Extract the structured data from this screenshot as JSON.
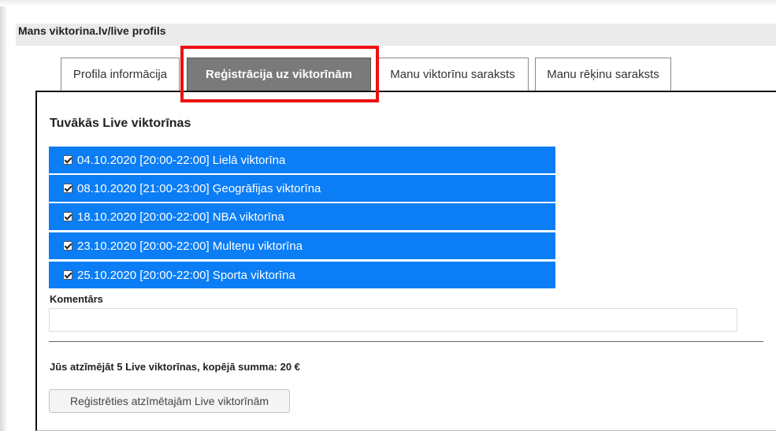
{
  "header": {
    "title": "Mans viktorina.lv/live profils"
  },
  "tabs": [
    {
      "label": "Profila informācija",
      "active": false
    },
    {
      "label": "Reģistrācija uz viktorīnām",
      "active": true
    },
    {
      "label": "Manu viktorīnu saraksts",
      "active": false
    },
    {
      "label": "Manu rēķinu saraksts",
      "active": false
    }
  ],
  "section": {
    "title": "Tuvākās Live viktorīnas"
  },
  "quizzes": [
    {
      "label": "04.10.2020 [20:00-22:00] Lielā viktorīna",
      "checked": true
    },
    {
      "label": "08.10.2020 [21:00-23:00] Ģeogrāfijas viktorīna",
      "checked": true
    },
    {
      "label": "18.10.2020 [20:00-22:00] NBA viktorīna",
      "checked": true
    },
    {
      "label": "23.10.2020 [20:00-22:00] Multeņu viktorīna",
      "checked": true
    },
    {
      "label": "25.10.2020 [20:00-22:00] Sporta viktorīna",
      "checked": true
    }
  ],
  "comment": {
    "label": "Komentārs",
    "value": ""
  },
  "summary": {
    "text": "Jūs atzīmējāt 5 Live viktorīnas, kopējā summa: 20 €"
  },
  "register_button": {
    "label": "Reģistrēties atzīmētajām Live viktorīnām"
  },
  "colors": {
    "item_blue": "#0b7df5",
    "active_tab": "#7a7a7a",
    "highlight_red": "#ee1111",
    "header_bg": "#ebebeb"
  }
}
